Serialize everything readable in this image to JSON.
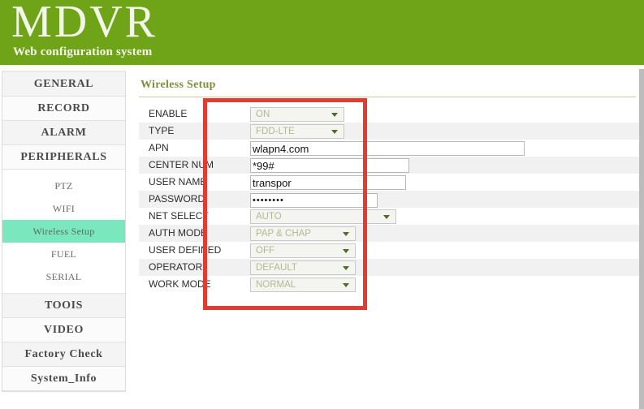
{
  "header": {
    "title": "MDVR",
    "subtitle": "Web configuration system",
    "brand_color": "#6fa318"
  },
  "sidebar": {
    "main_items": [
      {
        "label": "GENERAL"
      },
      {
        "label": "RECORD"
      },
      {
        "label": "ALARM"
      },
      {
        "label": "PERIPHERALS"
      }
    ],
    "sub_items": [
      {
        "label": "PTZ",
        "active": false
      },
      {
        "label": "WIFI",
        "active": false
      },
      {
        "label": "Wireless Setup",
        "active": true
      },
      {
        "label": "FUEL",
        "active": false
      },
      {
        "label": "SERIAL",
        "active": false
      }
    ],
    "bottom_items": [
      {
        "label": "TOOIS"
      },
      {
        "label": "VIDEO"
      },
      {
        "label": "Factory Check"
      },
      {
        "label": "System_Info"
      }
    ],
    "active_highlight_color": "#7ae7bf"
  },
  "content": {
    "panel_title": "Wireless Setup",
    "panel_title_color": "#7d8f3c",
    "rows": [
      {
        "label": "ENABLE",
        "type": "select",
        "value": "ON"
      },
      {
        "label": "TYPE",
        "type": "select",
        "value": "FDD-LTE"
      },
      {
        "label": "APN",
        "type": "text",
        "value": "wlapn4.com"
      },
      {
        "label": "CENTER NUM",
        "type": "text",
        "value": "*99#"
      },
      {
        "label": "USER NAME",
        "type": "text",
        "value": "transpor"
      },
      {
        "label": "PASSWORD",
        "type": "password",
        "value": "••••••••"
      },
      {
        "label": "NET SELECT",
        "type": "select",
        "value": "AUTO"
      },
      {
        "label": "AUTH MODE",
        "type": "select",
        "value": "PAP & CHAP"
      },
      {
        "label": "USER DEFINED",
        "type": "select",
        "value": "OFF"
      },
      {
        "label": "OPERATOR",
        "type": "select",
        "value": "DEFAULT"
      },
      {
        "label": "WORK MODE",
        "type": "select",
        "value": "NORMAL"
      }
    ]
  },
  "annotation": {
    "color": "#e03c31",
    "shape": "rectangle"
  }
}
